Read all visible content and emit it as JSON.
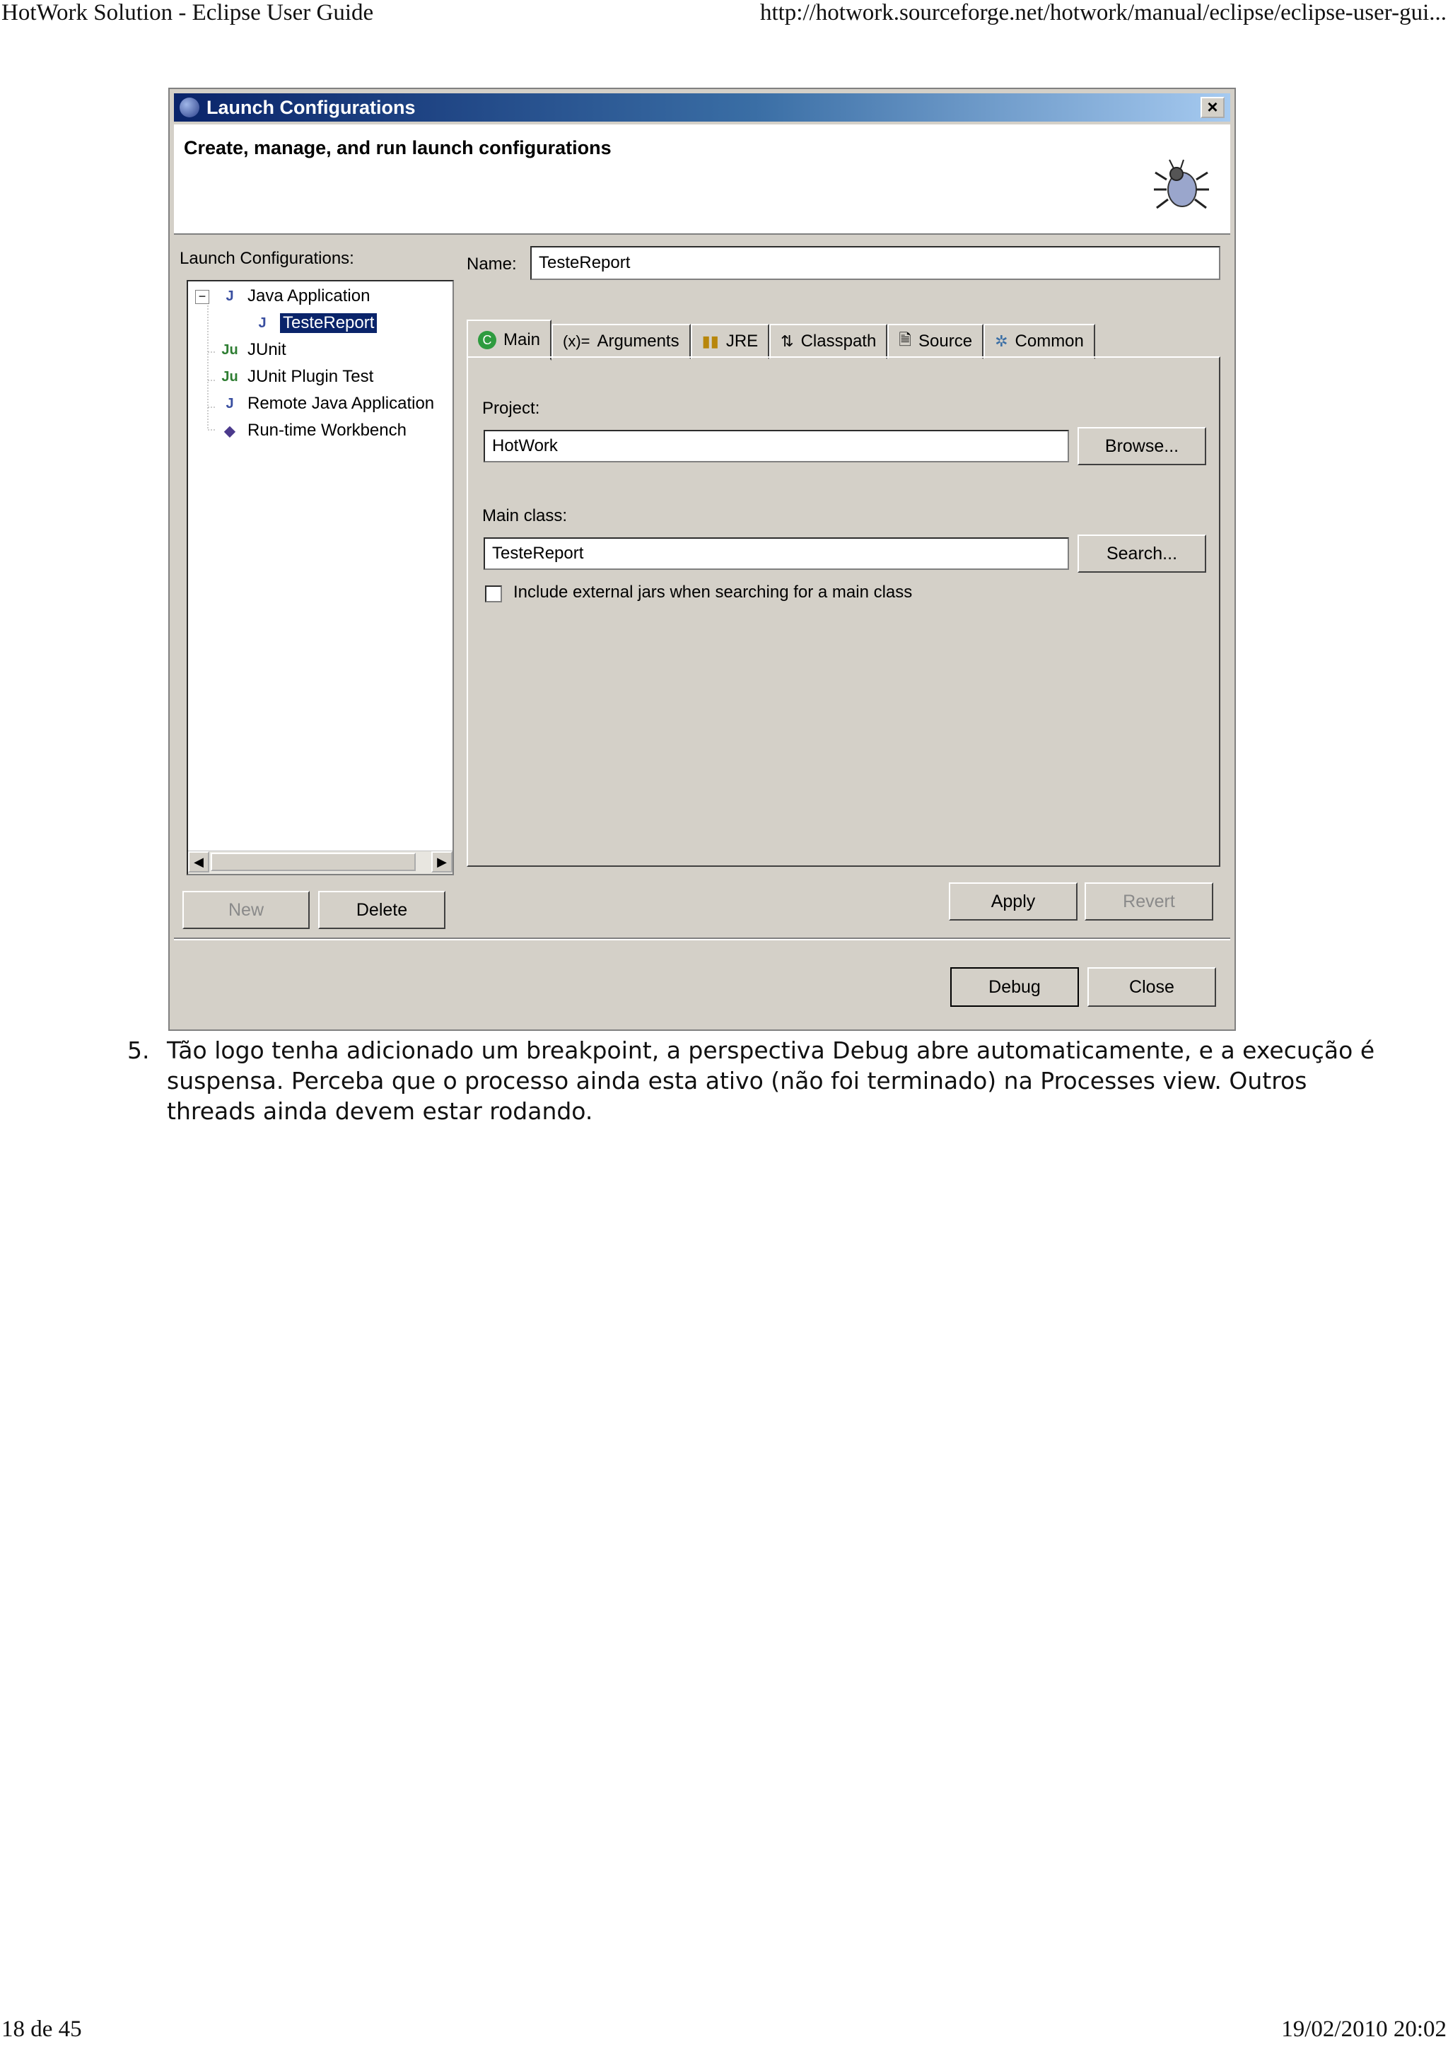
{
  "page": {
    "header_left": "HotWork Solution - Eclipse User Guide",
    "header_right": "http://hotwork.sourceforge.net/hotwork/manual/eclipse/eclipse-user-gui...",
    "footer_left": "18 de 45",
    "footer_right": "19/02/2010 20:02"
  },
  "dialog": {
    "title": "Launch Configurations",
    "close_glyph": "×",
    "banner_text": "Create, manage, and run launch configurations",
    "banner_icon": "bug-icon",
    "left": {
      "label": "Launch Configurations:",
      "tree": [
        {
          "label": "Java Application",
          "icon": "java-app-icon",
          "expanded": true
        },
        {
          "label": "TesteReport",
          "icon": "java-app-icon",
          "selected": true
        },
        {
          "label": "JUnit",
          "icon": "junit-icon"
        },
        {
          "label": "JUnit Plugin Test",
          "icon": "junit-plugin-icon"
        },
        {
          "label": "Remote Java Application",
          "icon": "remote-java-icon"
        },
        {
          "label": "Run-time Workbench",
          "icon": "workbench-icon"
        }
      ],
      "new_button": "New",
      "delete_button": "Delete"
    },
    "name_label": "Name:",
    "name_value": "TesteReport",
    "tabs": [
      {
        "label": "Main",
        "icon": "main-tab-icon",
        "active": true
      },
      {
        "label": "Arguments",
        "icon": "arguments-icon"
      },
      {
        "label": "JRE",
        "icon": "jre-icon"
      },
      {
        "label": "Classpath",
        "icon": "classpath-icon"
      },
      {
        "label": "Source",
        "icon": "source-icon"
      },
      {
        "label": "Common",
        "icon": "common-icon"
      }
    ],
    "main": {
      "project_label": "Project:",
      "project_value": "HotWork",
      "browse_button": "Browse...",
      "main_class_label": "Main class:",
      "main_class_value": "TesteReport",
      "search_button": "Search...",
      "include_external_jars": "Include external jars when searching for a main class",
      "include_external_checked": false
    },
    "apply_button": "Apply",
    "revert_button": "Revert",
    "debug_button": "Debug",
    "close_button": "Close"
  },
  "step": {
    "number": "5.",
    "text": "Tão logo tenha adicionado um breakpoint, a perspectiva Debug abre automaticamente, e a execução é suspensa. Perceba que o processo ainda esta ativo (não foi terminado) na Processes view. Outros threads ainda devem estar rodando."
  }
}
